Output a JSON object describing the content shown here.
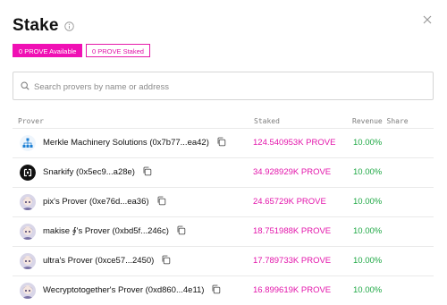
{
  "modal": {
    "title": "Stake",
    "available_label": "0 PROVE Available",
    "staked_label": "0 PROVE Staked"
  },
  "search": {
    "placeholder": "Search provers by name or address"
  },
  "table": {
    "headers": {
      "prover": "Prover",
      "staked": "Staked",
      "revenue_share": "Revenue Share"
    },
    "rows": [
      {
        "name": "Merkle Machinery Solutions (0x7b77...ea42)",
        "staked": "124.540953K PROVE",
        "share": "10.00%",
        "avatar": "network-logo"
      },
      {
        "name": "Snarkify (0x5ec9...a28e)",
        "staked": "34.928929K PROVE",
        "share": "10.00%",
        "avatar": "snarkify-logo"
      },
      {
        "name": "pix's Prover (0xe76d...ea36)",
        "staked": "24.65729K PROVE",
        "share": "10.00%",
        "avatar": "anime-avatar"
      },
      {
        "name": "makise ∮'s Prover (0xbd5f...246c)",
        "staked": "18.751988K PROVE",
        "share": "10.00%",
        "avatar": "anime-avatar"
      },
      {
        "name": "ultra's Prover (0xce57...2450)",
        "staked": "17.789733K PROVE",
        "share": "10.00%",
        "avatar": "anime-avatar"
      },
      {
        "name": "Wecryptotogether's Prover (0xd860...4e11)",
        "staked": "16.899619K PROVE",
        "share": "10.00%",
        "avatar": "anime-avatar"
      }
    ]
  },
  "colors": {
    "accent": "#f010b4",
    "positive": "#1fa845"
  }
}
